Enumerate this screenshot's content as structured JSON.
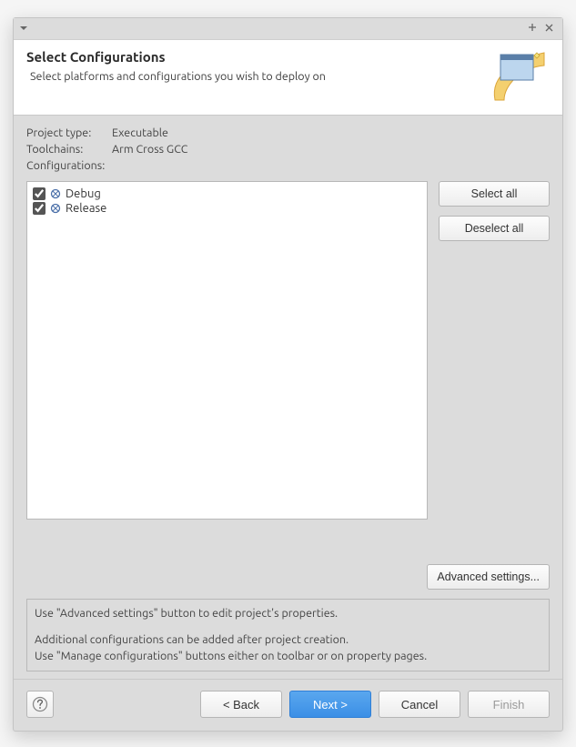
{
  "header": {
    "title": "Select Configurations",
    "subtitle": "Select platforms and configurations you wish to deploy on"
  },
  "info": {
    "project_type_label": "Project type:",
    "project_type_value": "Executable",
    "toolchains_label": "Toolchains:",
    "toolchains_value": "Arm Cross GCC",
    "configurations_label": "Configurations:"
  },
  "configurations": [
    {
      "label": "Debug",
      "checked": true
    },
    {
      "label": "Release",
      "checked": true
    }
  ],
  "buttons": {
    "select_all": "Select all",
    "deselect_all": "Deselect all",
    "advanced": "Advanced settings..."
  },
  "note": {
    "line1": "Use \"Advanced settings\" button to edit project's properties.",
    "line2": "Additional configurations can be added after project creation.",
    "line3": "Use \"Manage configurations\" buttons either on toolbar or on property pages."
  },
  "footer": {
    "back": "< Back",
    "next": "Next >",
    "cancel": "Cancel",
    "finish": "Finish"
  }
}
